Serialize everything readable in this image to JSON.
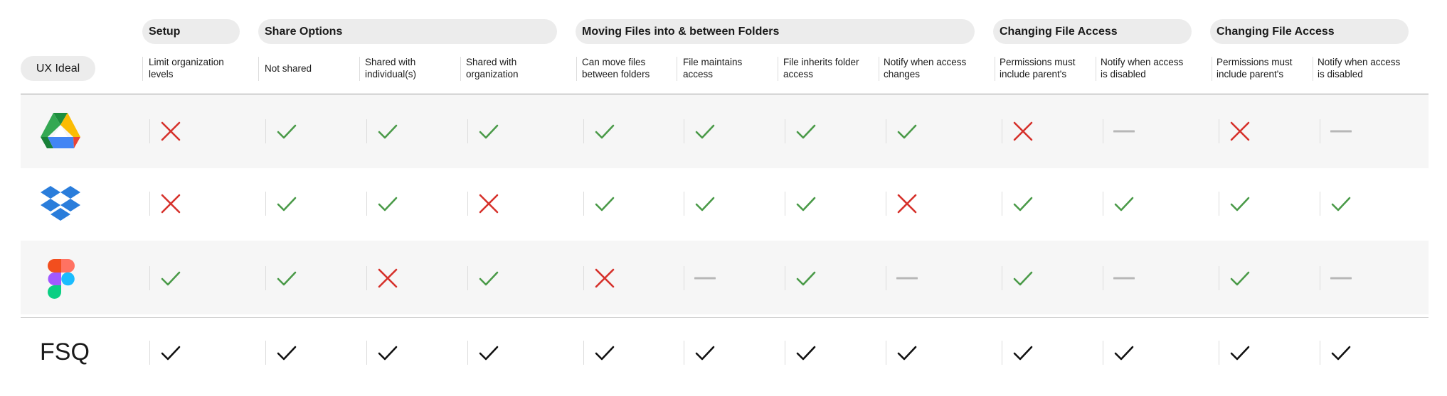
{
  "header": {
    "ux_ideal": "UX Ideal",
    "groups": [
      {
        "label": "Setup"
      },
      {
        "label": "Share Options"
      },
      {
        "label": "Moving Files into & between Folders"
      },
      {
        "label": "Changing File Access"
      },
      {
        "label": "Changing File Access"
      }
    ],
    "columns": [
      {
        "label": "Limit organization levels"
      },
      {
        "label": "Not shared"
      },
      {
        "label": "Shared with individual(s)"
      },
      {
        "label": "Shared with organization"
      },
      {
        "label": "Can move files between folders"
      },
      {
        "label": "File maintains access"
      },
      {
        "label": "File inherits folder access"
      },
      {
        "label": "Notify when access changes"
      },
      {
        "label": "Permissions must include parent's"
      },
      {
        "label": "Notify when access is disabled"
      },
      {
        "label": "Permissions must include parent's"
      },
      {
        "label": "Notify when access is disabled"
      }
    ]
  },
  "rows": [
    {
      "logo": "google-drive-logo",
      "cells": [
        "cross",
        "check",
        "check",
        "check",
        "check",
        "check",
        "check",
        "check",
        "cross",
        "dash",
        "cross",
        "dash"
      ]
    },
    {
      "logo": "dropbox-logo",
      "cells": [
        "cross",
        "check",
        "check",
        "cross",
        "check",
        "check",
        "check",
        "cross",
        "check",
        "check",
        "check",
        "check"
      ]
    },
    {
      "logo": "figma-logo",
      "cells": [
        "check",
        "check",
        "cross",
        "check",
        "cross",
        "dash",
        "check",
        "dash",
        "check",
        "dash",
        "check",
        "dash"
      ]
    },
    {
      "label": "FSQ",
      "cells": [
        "black-check",
        "black-check",
        "black-check",
        "black-check",
        "black-check",
        "black-check",
        "black-check",
        "black-check",
        "black-check",
        "black-check",
        "black-check",
        "black-check"
      ]
    }
  ],
  "colors": {
    "check": "#4a9a48",
    "cross": "#d6312b",
    "dash": "#b7b7b7",
    "black_check": "#111111",
    "band": "#f6f6f6",
    "pill": "#ececec"
  }
}
